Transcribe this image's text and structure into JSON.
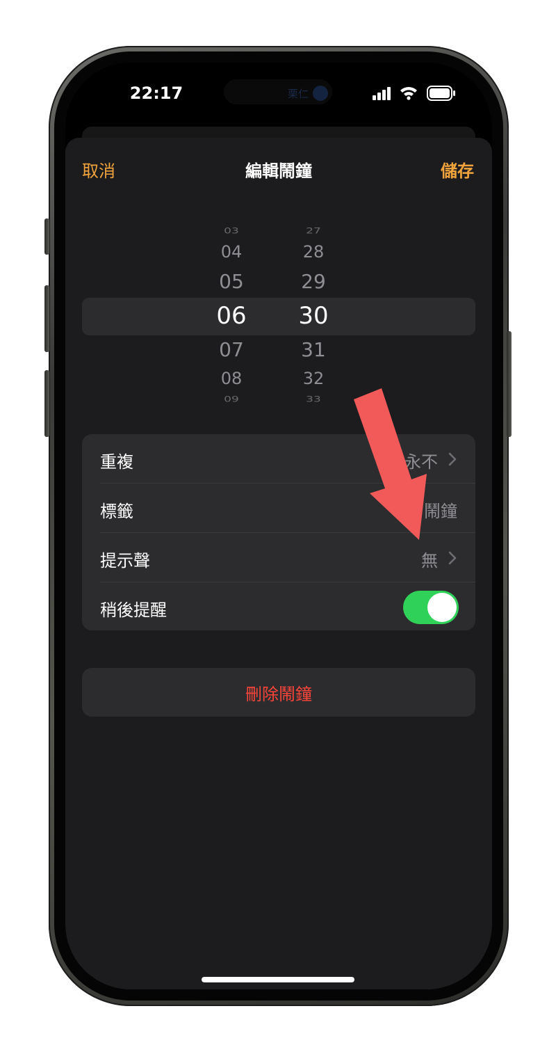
{
  "status_bar": {
    "time": "22:17",
    "island_text": "栗仁"
  },
  "nav": {
    "cancel": "取消",
    "title": "編輯鬧鐘",
    "save": "儲存"
  },
  "picker": {
    "hours": [
      "03",
      "04",
      "05",
      "06",
      "07",
      "08",
      "09"
    ],
    "minutes": [
      "27",
      "28",
      "29",
      "30",
      "31",
      "32",
      "33"
    ],
    "selected_hour": "06",
    "selected_minute": "30"
  },
  "settings": {
    "repeat_label": "重複",
    "repeat_value": "永不",
    "label_label": "標籤",
    "label_value": "鬧鐘",
    "sound_label": "提示聲",
    "sound_value": "無",
    "snooze_label": "稍後提醒",
    "snooze_on": true
  },
  "delete_label": "刪除鬧鐘",
  "colors": {
    "accent": "#f1a33c",
    "destructive": "#ff453a",
    "toggle_on": "#30d158",
    "annotation_arrow": "#f25a5a"
  }
}
